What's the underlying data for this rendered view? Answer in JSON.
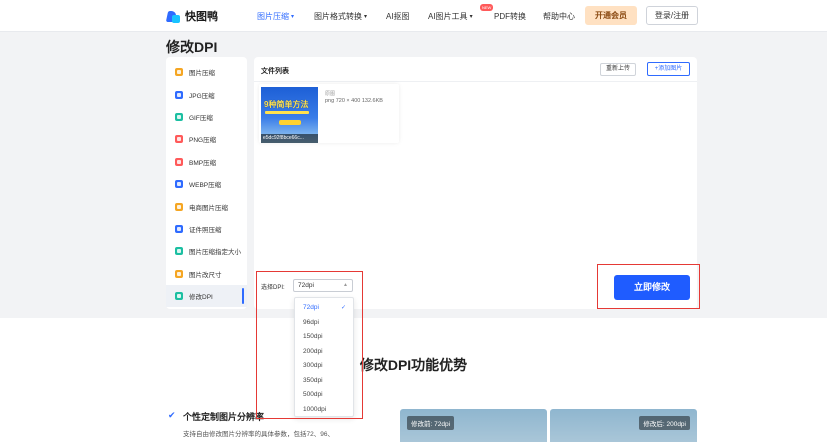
{
  "brand": {
    "name": "快图鸭",
    "primary_color": "#2f6bff",
    "highlight_color": "#e53935"
  },
  "nav": {
    "items": [
      {
        "label": "图片压缩",
        "caret": true,
        "active": true
      },
      {
        "label": "图片格式转换",
        "caret": true
      },
      {
        "label": "AI抠图",
        "caret": false
      },
      {
        "label": "AI图片工具",
        "caret": true
      },
      {
        "label": "PDF转换",
        "caret": false
      },
      {
        "label": "帮助中心",
        "caret": false
      }
    ],
    "new_badge": "NEW",
    "vip_label": "开通会员",
    "login_label": "登录/注册"
  },
  "page_title": "修改DPI",
  "sidebar": {
    "items": [
      {
        "label": "图片压缩",
        "icon": "compress-icon",
        "color": "#f5a623"
      },
      {
        "label": "JPG压缩",
        "icon": "jpg-icon",
        "color": "#2f6bff"
      },
      {
        "label": "GIF压缩",
        "icon": "gif-icon",
        "color": "#1cbfa2"
      },
      {
        "label": "PNG压缩",
        "icon": "png-icon",
        "color": "#ff5a5a"
      },
      {
        "label": "BMP压缩",
        "icon": "bmp-icon",
        "color": "#ff5a5a"
      },
      {
        "label": "WEBP压缩",
        "icon": "webp-icon",
        "color": "#2f6bff"
      },
      {
        "label": "电商图片压缩",
        "icon": "ecommerce-icon",
        "color": "#f5a623"
      },
      {
        "label": "证件照压缩",
        "icon": "id-photo-icon",
        "color": "#2f6bff"
      },
      {
        "label": "图片压缩指定大小",
        "icon": "target-size-icon",
        "color": "#1cbfa2"
      },
      {
        "label": "图片改尺寸",
        "icon": "resize-icon",
        "color": "#f5a623"
      },
      {
        "label": "修改DPI",
        "icon": "dpi-icon",
        "color": "#1cbfa2",
        "active": true
      }
    ]
  },
  "panel": {
    "title": "文件列表",
    "reupload_label": "重新上传",
    "add_label": "+添加图片",
    "file": {
      "thumb_title": "9种简单方法",
      "name": "e5dc92f8bce66c...",
      "label": "原图",
      "meta": "png  720 × 400  132.6KB"
    },
    "dpi_label": "选择DPI:",
    "dpi_selected": "72dpi",
    "modify_label": "立即修改"
  },
  "dropdown": {
    "options": [
      "72dpi",
      "96dpi",
      "150dpi",
      "200dpi",
      "300dpi",
      "350dpi",
      "500dpi",
      "1000dpi"
    ],
    "selected": "72dpi"
  },
  "lower": {
    "heading": "修改DPI功能优势",
    "feature_title": "个性定制图片分辨率",
    "feature_desc": "支持自由修改图片分辨率的具体参数，包括72、96、",
    "before_label": "修改前: 72dpi",
    "after_label": "修改后: 200dpi"
  }
}
